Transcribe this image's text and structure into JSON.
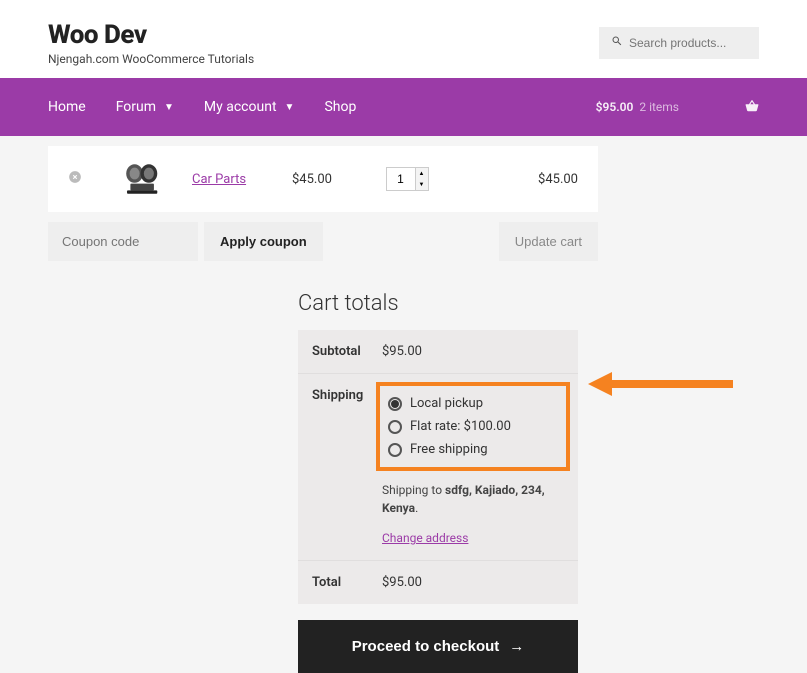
{
  "brand": {
    "title": "Woo Dev",
    "subtitle": "Njengah.com WooCommerce Tutorials"
  },
  "search": {
    "placeholder": "Search products..."
  },
  "nav": {
    "items": [
      {
        "label": "Home"
      },
      {
        "label": "Forum"
      },
      {
        "label": "My account"
      },
      {
        "label": "Shop"
      }
    ],
    "cart": {
      "amount": "$95.00",
      "items_text": "2 items"
    }
  },
  "cart_row": {
    "product_name": "Car Parts",
    "price": "$45.00",
    "qty": "1",
    "subtotal": "$45.00"
  },
  "coupon": {
    "placeholder": "Coupon code",
    "apply_label": "Apply coupon",
    "update_label": "Update cart"
  },
  "totals": {
    "title": "Cart totals",
    "subtotal_label": "Subtotal",
    "subtotal_value": "$95.00",
    "shipping_label": "Shipping",
    "shipping_options": [
      {
        "label": "Local pickup",
        "checked": true
      },
      {
        "label": "Flat rate: $100.00",
        "checked": false
      },
      {
        "label": "Free shipping",
        "checked": false
      }
    ],
    "shipping_to_prefix": "Shipping to ",
    "shipping_to_address": "sdfg, Kajiado, 234, Kenya",
    "change_address": "Change address",
    "total_label": "Total",
    "total_value": "$95.00"
  },
  "checkout": {
    "label": "Proceed to checkout"
  },
  "colors": {
    "accent": "#9b3ba7",
    "highlight": "#f58220"
  }
}
